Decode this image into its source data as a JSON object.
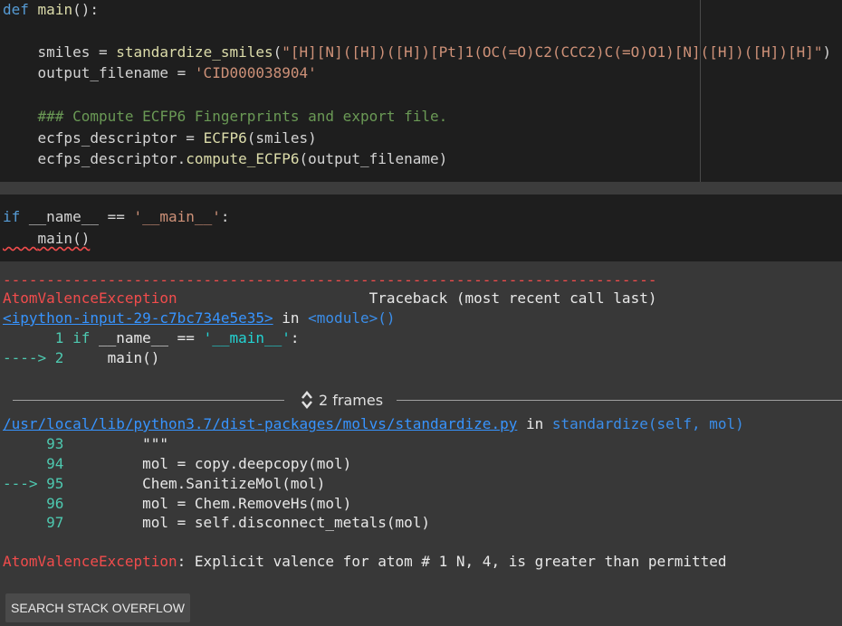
{
  "cell1": {
    "l1a": "def",
    "l1b": "main",
    "l1c": "():",
    "l2a": "    smiles = ",
    "l2b": "standardize_smiles",
    "l2c": "(",
    "l2d": "\"[H][N]([H])([H])[Pt]1(OC(=O)C2(CCC2)C(=O)O1)[N]([H])([H])[H]\"",
    "l2e": ")",
    "l3a": "    output_filename = ",
    "l3b": "'CID000038904'",
    "l4": "    ### Compute ECFP6 Fingerprints and export file.",
    "l5a": "    ecfps_descriptor = ",
    "l5b": "ECFP6",
    "l5c": "(smiles)",
    "l6a": "    ecfps_descriptor.",
    "l6b": "compute_ECFP6",
    "l6c": "(output_filename)"
  },
  "cell2": {
    "l1a": "if",
    "l1b": " __name__ == ",
    "l1c": "'__main__'",
    "l1d": ":",
    "l2a": "    ",
    "l2b": "main()"
  },
  "output": {
    "dashes": "---------------------------------------------------------------------------",
    "exception_name": "AtomValenceException",
    "traceback_spacer": "                      ",
    "traceback_label": "Traceback (most recent call last)",
    "input_link": "<ipython-input-29-c7bc734e5e35>",
    "in_module_a": " in ",
    "in_module_b": "<module>()",
    "tb1_num": "      1 ",
    "tb1_a": "if",
    "tb1_b": " __name__ ",
    "tb1_c": "==",
    "tb1_d": " ",
    "tb1_e": "'__main__'",
    "tb1_f": ":",
    "tb2_arrow": "----> 2 ",
    "tb2_code": "    main()",
    "frames_label": "2 frames",
    "file_link": "/usr/local/lib/python3.7/dist-packages/molvs/standardize.py",
    "in_func_a": " in ",
    "in_func_b": "standardize(self, mol)",
    "src": [
      {
        "num": "     93 ",
        "code": "        \"\"\""
      },
      {
        "num": "     94 ",
        "code": "        mol = copy.deepcopy(mol)"
      },
      {
        "num": "---> 95 ",
        "code": "        Chem.SanitizeMol(mol)"
      },
      {
        "num": "     96 ",
        "code": "        mol = Chem.RemoveHs(mol)"
      },
      {
        "num": "     97 ",
        "code": "        mol = self.disconnect_metals(mol)"
      }
    ],
    "final_exc": "AtomValenceException",
    "final_msg": ": Explicit valence for atom # 1 N, 4, is greater than permitted"
  },
  "button": {
    "label": "SEARCH STACK OVERFLOW"
  }
}
